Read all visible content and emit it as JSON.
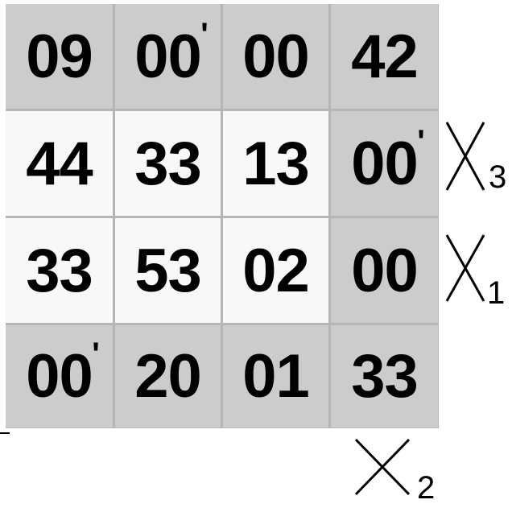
{
  "grid": {
    "rows": [
      {
        "cells": [
          {
            "value": "09",
            "tick": "",
            "shade": "gray"
          },
          {
            "value": "00",
            "tick": "'",
            "shade": "gray"
          },
          {
            "value": "00",
            "tick": "",
            "shade": "gray"
          },
          {
            "value": "42",
            "tick": "",
            "shade": "gray"
          }
        ]
      },
      {
        "cells": [
          {
            "value": "44",
            "tick": "",
            "shade": "white"
          },
          {
            "value": "33",
            "tick": "",
            "shade": "white"
          },
          {
            "value": "13",
            "tick": "",
            "shade": "white"
          },
          {
            "value": "00",
            "tick": "'",
            "shade": "gray"
          }
        ]
      },
      {
        "cells": [
          {
            "value": "33",
            "tick": "",
            "shade": "white"
          },
          {
            "value": "53",
            "tick": "",
            "shade": "white"
          },
          {
            "value": "02",
            "tick": "",
            "shade": "white"
          },
          {
            "value": "00",
            "tick": "",
            "shade": "gray"
          }
        ]
      },
      {
        "cells": [
          {
            "value": "00",
            "tick": "'",
            "shade": "gray"
          },
          {
            "value": "20",
            "tick": "",
            "shade": "gray"
          },
          {
            "value": "01",
            "tick": "",
            "shade": "gray"
          },
          {
            "value": "33",
            "tick": "",
            "shade": "gray"
          }
        ]
      }
    ]
  },
  "variables": {
    "x3": {
      "symbol": "X",
      "subscript": "3"
    },
    "x1": {
      "symbol": "X",
      "subscript": "1"
    },
    "x2": {
      "symbol": "X",
      "subscript": "2"
    }
  },
  "colors": {
    "cell_gray": "#cccccc",
    "cell_white": "#f8f8f8",
    "grid_line": "#b5b5b5",
    "text": "#000000"
  }
}
